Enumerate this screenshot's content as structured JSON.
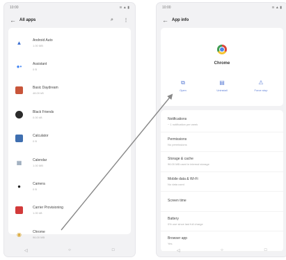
{
  "left_screen": {
    "status": {
      "time": "10:00",
      "icons": "≋ ▲ ▮"
    },
    "header": {
      "title": "All apps",
      "back_icon": "arrow-left-icon",
      "search_icon": "search-icon",
      "menu_icon": "more-icon"
    },
    "apps": [
      {
        "name": "Android Auto",
        "size": "1.00 MB",
        "icon": "android-auto-icon",
        "color": "#3c6fd1"
      },
      {
        "name": "Assistant",
        "size": "0 B",
        "icon": "assistant-icon",
        "color": "#4285f4"
      },
      {
        "name": "Basic Daydream",
        "size": "48.00 kB",
        "icon": "daydream-icon",
        "color": "#c8553a"
      },
      {
        "name": "Black Friends",
        "size": "0.00 kB",
        "icon": "black-friends-icon",
        "color": "#2b2b2b"
      },
      {
        "name": "Calculator",
        "size": "0 B",
        "icon": "calculator-icon",
        "color": "#3f6fb0"
      },
      {
        "name": "Calendar",
        "size": "1.00 MB",
        "icon": "calendar-icon",
        "color": "#7a8fa6"
      },
      {
        "name": "Camera",
        "size": "0 B",
        "icon": "camera-icon",
        "color": "#222222"
      },
      {
        "name": "Carrier Provisioning",
        "size": "1.00 kB",
        "icon": "carrier-icon",
        "color": "#d23a3a"
      },
      {
        "name": "Chrome",
        "size": "96.00 MB",
        "icon": "chrome-icon",
        "color": "#dba93a"
      }
    ],
    "nav": [
      "◁",
      "○",
      "□"
    ]
  },
  "right_screen": {
    "status": {
      "time": "10:00",
      "icons": "≋ ▲ ▮"
    },
    "header": {
      "title": "App info",
      "back_icon": "arrow-left-icon"
    },
    "app": {
      "name": "Chrome"
    },
    "actions": [
      {
        "label": "Open",
        "glyph": "⧉",
        "icon": "open-icon"
      },
      {
        "label": "Uninstall",
        "glyph": "▤",
        "icon": "uninstall-icon"
      },
      {
        "label": "Force stop",
        "glyph": "⚠",
        "icon": "force-stop-icon"
      }
    ],
    "settings": [
      {
        "title": "Notifications",
        "subtitle": "~ 1 notification per week"
      },
      {
        "title": "Permissions",
        "subtitle": "No permissions"
      },
      {
        "title": "Storage & cache",
        "subtitle": "96.00 MB used in internal storage"
      },
      {
        "title": "Mobile data & Wi-Fi",
        "subtitle": "No data used"
      },
      {
        "title": "Screen time",
        "subtitle": ""
      },
      {
        "title": "Battery",
        "subtitle": "0% use since last full charge"
      },
      {
        "title": "Browser app",
        "subtitle": "Yes"
      }
    ],
    "nav": [
      "◁",
      "○",
      "□"
    ]
  },
  "annotation": {
    "arrow_color": "#888888"
  }
}
